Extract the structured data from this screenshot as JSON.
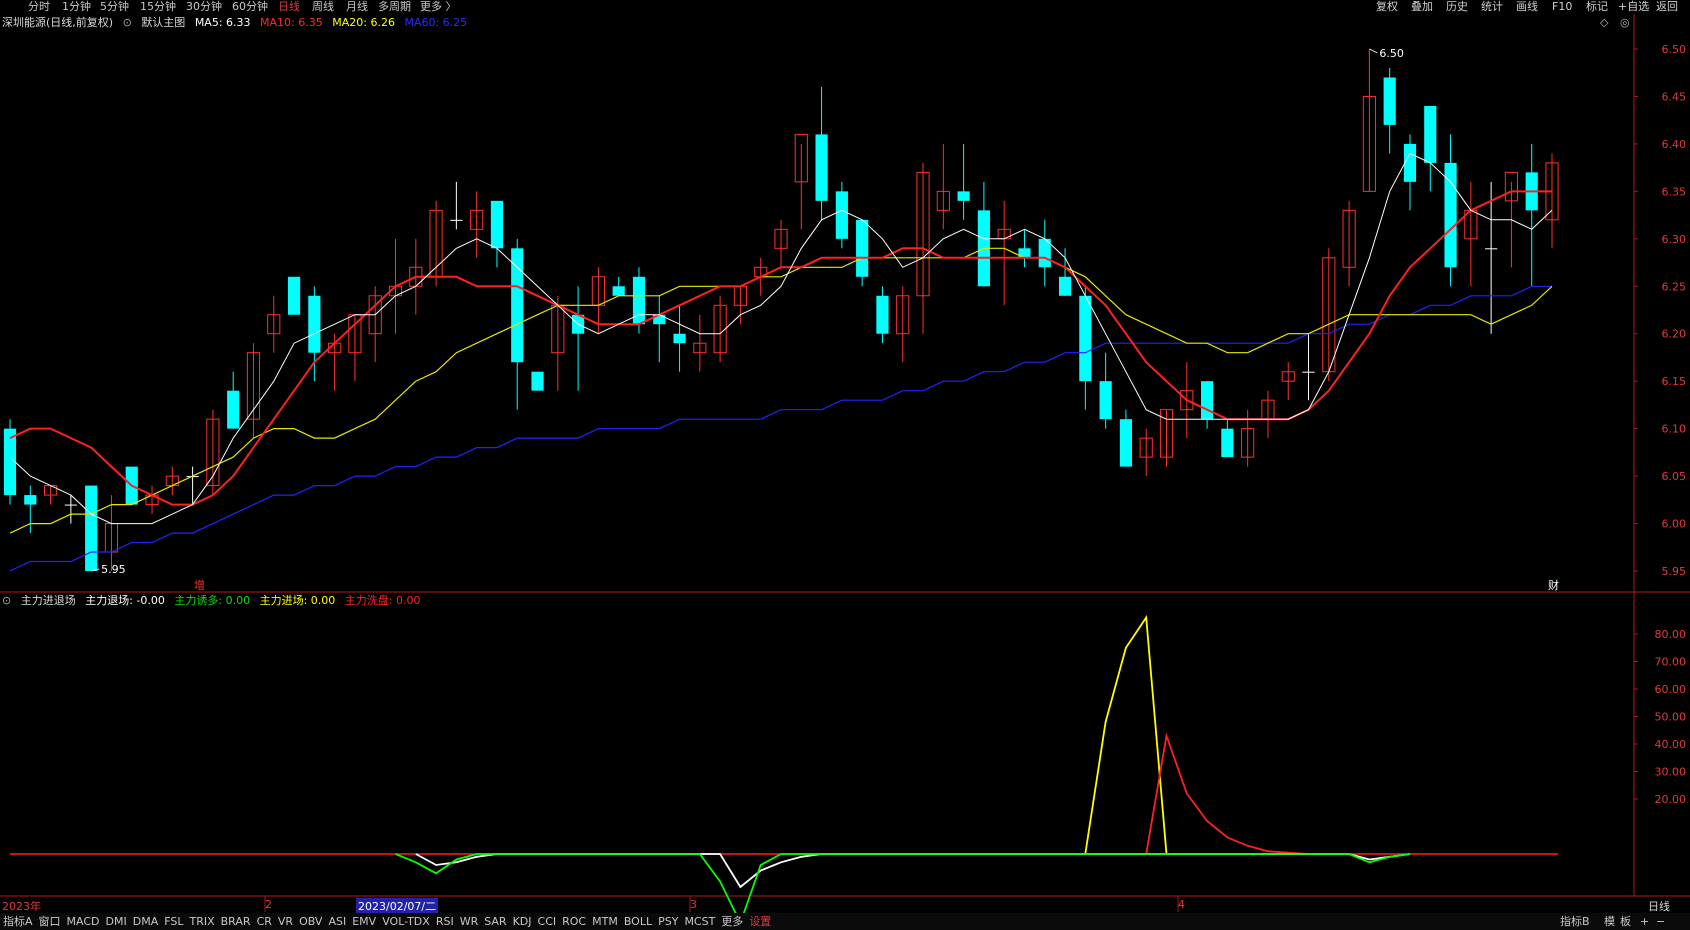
{
  "top_periods": [
    {
      "label": "分时",
      "active": false
    },
    {
      "label": "1分钟",
      "active": false
    },
    {
      "label": "5分钟",
      "active": false
    },
    {
      "label": "15分钟",
      "active": false
    },
    {
      "label": "30分钟",
      "active": false
    },
    {
      "label": "60分钟",
      "active": false
    },
    {
      "label": "日线",
      "active": true
    },
    {
      "label": "周线",
      "active": false
    },
    {
      "label": "月线",
      "active": false
    },
    {
      "label": "多周期",
      "active": false
    },
    {
      "label": "更多 〉",
      "active": false
    }
  ],
  "top_right": [
    "复权",
    "叠加",
    "历史",
    "统计",
    "画线",
    "F10",
    "标记",
    "+自选",
    "返回"
  ],
  "main_legend": {
    "stock": "深圳能源(日线,前复权)",
    "chart_name": "默认主图",
    "ma5": "MA5: 6.33",
    "ma10": "MA10: 6.35",
    "ma20": "MA20: 6.26",
    "ma60": "MA60: 6.25"
  },
  "sub_legend": {
    "name": "主力进退场",
    "exit": "主力退场: -0.00",
    "lure": "主力诱多: 0.00",
    "enter": "主力进场: 0.00",
    "wash": "主力洗盘: 0.00"
  },
  "main_axis": [
    "6.50",
    "6.45",
    "6.40",
    "6.35",
    "6.30",
    "6.25",
    "6.20",
    "6.15",
    "6.10",
    "6.05",
    "6.00",
    "5.95"
  ],
  "sub_axis": [
    "80.00",
    "70.00",
    "60.00",
    "50.00",
    "40.00",
    "30.00",
    "20.00"
  ],
  "annotations": {
    "high": "6.50",
    "low": "5.95",
    "zeng": "增",
    "cai": "财"
  },
  "time_axis": {
    "t1": "2023年",
    "t2": "2",
    "t3": "2023/02/07/二",
    "t4": "3",
    "t5": "4"
  },
  "period_label": "日线",
  "bottom_tabs": [
    {
      "label": "指标A",
      "red": false
    },
    {
      "label": "窗口",
      "red": false
    },
    {
      "label": "MACD",
      "red": false
    },
    {
      "label": "DMI",
      "red": false
    },
    {
      "label": "DMA",
      "red": false
    },
    {
      "label": "FSL",
      "red": false
    },
    {
      "label": "TRIX",
      "red": false
    },
    {
      "label": "BRAR",
      "red": false
    },
    {
      "label": "CR",
      "red": false
    },
    {
      "label": "VR",
      "red": false
    },
    {
      "label": "OBV",
      "red": false
    },
    {
      "label": "ASI",
      "red": false
    },
    {
      "label": "EMV",
      "red": false
    },
    {
      "label": "VOL-TDX",
      "red": false
    },
    {
      "label": "RSI",
      "red": false
    },
    {
      "label": "WR",
      "red": false
    },
    {
      "label": "SAR",
      "red": false
    },
    {
      "label": "KDJ",
      "red": false
    },
    {
      "label": "CCI",
      "red": false
    },
    {
      "label": "ROC",
      "red": false
    },
    {
      "label": "MTM",
      "red": false
    },
    {
      "label": "BOLL",
      "red": false
    },
    {
      "label": "PSY",
      "red": false
    },
    {
      "label": "MCST",
      "red": false
    },
    {
      "label": "更多",
      "red": false
    },
    {
      "label": "设置",
      "red": true
    }
  ],
  "bottom_right": [
    "指标B",
    "模",
    "板",
    "+",
    "−"
  ],
  "chart_data": [
    {
      "type": "candlestick",
      "title": "深圳能源(日线,前复权)",
      "ylim": [
        5.93,
        6.52
      ],
      "ohlc": [
        [
          6.1,
          6.11,
          6.02,
          6.03
        ],
        [
          6.03,
          6.04,
          5.99,
          6.02
        ],
        [
          6.03,
          6.04,
          6.02,
          6.04
        ],
        [
          6.02,
          6.03,
          6.0,
          6.02
        ],
        [
          6.04,
          6.04,
          5.95,
          5.95
        ],
        [
          5.97,
          6.03,
          5.95,
          6.0
        ],
        [
          6.06,
          6.06,
          6.02,
          6.02
        ],
        [
          6.02,
          6.04,
          6.01,
          6.03
        ],
        [
          6.04,
          6.06,
          6.03,
          6.05
        ],
        [
          6.05,
          6.06,
          6.02,
          6.05
        ],
        [
          6.04,
          6.12,
          6.03,
          6.11
        ],
        [
          6.14,
          6.16,
          6.1,
          6.1
        ],
        [
          6.11,
          6.19,
          6.09,
          6.18
        ],
        [
          6.2,
          6.24,
          6.18,
          6.22
        ],
        [
          6.26,
          6.26,
          6.22,
          6.22
        ],
        [
          6.24,
          6.25,
          6.15,
          6.18
        ],
        [
          6.18,
          6.2,
          6.14,
          6.19
        ],
        [
          6.18,
          6.22,
          6.15,
          6.22
        ],
        [
          6.2,
          6.25,
          6.17,
          6.24
        ],
        [
          6.24,
          6.3,
          6.2,
          6.25
        ],
        [
          6.25,
          6.3,
          6.22,
          6.27
        ],
        [
          6.26,
          6.34,
          6.25,
          6.33
        ],
        [
          6.32,
          6.36,
          6.31,
          6.32
        ],
        [
          6.31,
          6.35,
          6.28,
          6.33
        ],
        [
          6.34,
          6.34,
          6.27,
          6.29
        ],
        [
          6.29,
          6.3,
          6.12,
          6.17
        ],
        [
          6.16,
          6.16,
          6.14,
          6.14
        ],
        [
          6.18,
          6.24,
          6.14,
          6.23
        ],
        [
          6.22,
          6.25,
          6.14,
          6.2
        ],
        [
          6.23,
          6.27,
          6.2,
          6.26
        ],
        [
          6.25,
          6.26,
          6.24,
          6.24
        ],
        [
          6.26,
          6.27,
          6.2,
          6.21
        ],
        [
          6.22,
          6.24,
          6.17,
          6.21
        ],
        [
          6.2,
          6.23,
          6.16,
          6.19
        ],
        [
          6.18,
          6.22,
          6.16,
          6.19
        ],
        [
          6.18,
          6.24,
          6.17,
          6.23
        ],
        [
          6.23,
          6.25,
          6.21,
          6.25
        ],
        [
          6.26,
          6.28,
          6.24,
          6.27
        ],
        [
          6.29,
          6.32,
          6.27,
          6.31
        ],
        [
          6.36,
          6.4,
          6.31,
          6.41
        ],
        [
          6.41,
          6.46,
          6.32,
          6.34
        ],
        [
          6.35,
          6.36,
          6.29,
          6.3
        ],
        [
          6.32,
          6.32,
          6.25,
          6.26
        ],
        [
          6.24,
          6.25,
          6.19,
          6.2
        ],
        [
          6.2,
          6.25,
          6.17,
          6.24
        ],
        [
          6.24,
          6.38,
          6.2,
          6.37
        ],
        [
          6.33,
          6.4,
          6.31,
          6.35
        ],
        [
          6.35,
          6.4,
          6.32,
          6.34
        ],
        [
          6.33,
          6.36,
          6.25,
          6.25
        ],
        [
          6.3,
          6.34,
          6.23,
          6.31
        ],
        [
          6.29,
          6.31,
          6.27,
          6.28
        ],
        [
          6.3,
          6.32,
          6.25,
          6.27
        ],
        [
          6.26,
          6.29,
          6.24,
          6.24
        ],
        [
          6.24,
          6.25,
          6.12,
          6.15
        ],
        [
          6.15,
          6.18,
          6.1,
          6.11
        ],
        [
          6.11,
          6.12,
          6.06,
          6.06
        ],
        [
          6.07,
          6.1,
          6.05,
          6.09
        ],
        [
          6.07,
          6.12,
          6.06,
          6.12
        ],
        [
          6.12,
          6.17,
          6.09,
          6.14
        ],
        [
          6.15,
          6.15,
          6.1,
          6.11
        ],
        [
          6.1,
          6.11,
          6.07,
          6.07
        ],
        [
          6.07,
          6.12,
          6.06,
          6.1
        ],
        [
          6.11,
          6.14,
          6.09,
          6.13
        ],
        [
          6.15,
          6.17,
          6.13,
          6.16
        ],
        [
          6.16,
          6.2,
          6.13,
          6.16
        ],
        [
          6.16,
          6.29,
          6.15,
          6.28
        ],
        [
          6.27,
          6.34,
          6.25,
          6.33
        ],
        [
          6.35,
          6.5,
          6.35,
          6.45
        ],
        [
          6.47,
          6.48,
          6.39,
          6.42
        ],
        [
          6.4,
          6.41,
          6.33,
          6.36
        ],
        [
          6.44,
          6.44,
          6.35,
          6.38
        ],
        [
          6.38,
          6.41,
          6.25,
          6.27
        ],
        [
          6.3,
          6.36,
          6.25,
          6.33
        ],
        [
          6.29,
          6.36,
          6.2,
          6.29
        ],
        [
          6.34,
          6.36,
          6.27,
          6.37
        ],
        [
          6.37,
          6.4,
          6.25,
          6.33
        ],
        [
          6.32,
          6.39,
          6.29,
          6.38
        ]
      ],
      "ma5": [
        6.07,
        6.05,
        6.04,
        6.03,
        6.01,
        6.0,
        6.0,
        6.0,
        6.01,
        6.02,
        6.05,
        6.09,
        6.12,
        6.15,
        6.19,
        6.2,
        6.21,
        6.22,
        6.22,
        6.24,
        6.25,
        6.27,
        6.29,
        6.3,
        6.29,
        6.27,
        6.25,
        6.23,
        6.21,
        6.2,
        6.21,
        6.22,
        6.22,
        6.21,
        6.2,
        6.2,
        6.22,
        6.23,
        6.25,
        6.29,
        6.32,
        6.33,
        6.32,
        6.3,
        6.27,
        6.28,
        6.3,
        6.31,
        6.3,
        6.3,
        6.31,
        6.3,
        6.28,
        6.24,
        6.2,
        6.16,
        6.12,
        6.11,
        6.11,
        6.11,
        6.11,
        6.11,
        6.11,
        6.11,
        6.12,
        6.16,
        6.22,
        6.28,
        6.35,
        6.39,
        6.38,
        6.36,
        6.33,
        6.32,
        6.32,
        6.31,
        6.33
      ],
      "ma10": [
        6.09,
        6.1,
        6.1,
        6.09,
        6.08,
        6.06,
        6.04,
        6.03,
        6.02,
        6.02,
        6.03,
        6.05,
        6.08,
        6.11,
        6.14,
        6.17,
        6.19,
        6.21,
        6.23,
        6.25,
        6.26,
        6.26,
        6.26,
        6.25,
        6.25,
        6.25,
        6.24,
        6.23,
        6.22,
        6.21,
        6.21,
        6.21,
        6.22,
        6.23,
        6.24,
        6.25,
        6.25,
        6.26,
        6.27,
        6.27,
        6.28,
        6.28,
        6.28,
        6.28,
        6.29,
        6.29,
        6.28,
        6.28,
        6.28,
        6.28,
        6.28,
        6.28,
        6.27,
        6.25,
        6.23,
        6.2,
        6.17,
        6.15,
        6.13,
        6.12,
        6.11,
        6.11,
        6.11,
        6.11,
        6.12,
        6.14,
        6.17,
        6.2,
        6.24,
        6.27,
        6.29,
        6.31,
        6.33,
        6.34,
        6.35,
        6.35,
        6.35
      ],
      "ma20": [
        5.99,
        6.0,
        6.0,
        6.01,
        6.01,
        6.02,
        6.02,
        6.03,
        6.04,
        6.05,
        6.06,
        6.07,
        6.09,
        6.1,
        6.1,
        6.09,
        6.09,
        6.1,
        6.11,
        6.13,
        6.15,
        6.16,
        6.18,
        6.19,
        6.2,
        6.21,
        6.22,
        6.23,
        6.23,
        6.23,
        6.24,
        6.24,
        6.24,
        6.25,
        6.25,
        6.25,
        6.25,
        6.26,
        6.26,
        6.27,
        6.27,
        6.27,
        6.28,
        6.28,
        6.28,
        6.28,
        6.28,
        6.28,
        6.29,
        6.29,
        6.28,
        6.28,
        6.27,
        6.26,
        6.24,
        6.22,
        6.21,
        6.2,
        6.19,
        6.19,
        6.18,
        6.18,
        6.19,
        6.2,
        6.2,
        6.21,
        6.22,
        6.22,
        6.22,
        6.22,
        6.22,
        6.22,
        6.22,
        6.21,
        6.22,
        6.23,
        6.25
      ],
      "ma60": [
        5.95,
        5.96,
        5.96,
        5.96,
        5.97,
        5.97,
        5.98,
        5.98,
        5.99,
        5.99,
        6.0,
        6.01,
        6.02,
        6.03,
        6.03,
        6.04,
        6.04,
        6.05,
        6.05,
        6.06,
        6.06,
        6.07,
        6.07,
        6.08,
        6.08,
        6.09,
        6.09,
        6.09,
        6.09,
        6.1,
        6.1,
        6.1,
        6.1,
        6.11,
        6.11,
        6.11,
        6.11,
        6.11,
        6.12,
        6.12,
        6.12,
        6.13,
        6.13,
        6.13,
        6.14,
        6.14,
        6.15,
        6.15,
        6.16,
        6.16,
        6.17,
        6.17,
        6.18,
        6.18,
        6.19,
        6.19,
        6.19,
        6.19,
        6.19,
        6.19,
        6.19,
        6.19,
        6.19,
        6.19,
        6.2,
        6.2,
        6.21,
        6.21,
        6.22,
        6.22,
        6.23,
        6.23,
        6.24,
        6.24,
        6.24,
        6.25,
        6.25
      ]
    },
    {
      "type": "line",
      "title": "主力进退场",
      "ylim": [
        -15,
        90
      ],
      "series": [
        {
          "name": "主力进场",
          "color": "#ffff00",
          "values": [
            [
              53,
              0
            ],
            [
              54,
              48
            ],
            [
              55,
              75
            ],
            [
              56,
              86
            ],
            [
              57,
              0
            ]
          ]
        },
        {
          "name": "主力洗盘",
          "color": "#ff2020",
          "values": [
            [
              56,
              0
            ],
            [
              57,
              43
            ],
            [
              58,
              22
            ],
            [
              59,
              12
            ],
            [
              60,
              6
            ],
            [
              61,
              3
            ],
            [
              62,
              1
            ],
            [
              63,
              0.5
            ],
            [
              64,
              0
            ]
          ]
        },
        {
          "name": "主力退场",
          "color": "#ffffff",
          "values": [
            [
              20,
              0
            ],
            [
              21,
              -4
            ],
            [
              22,
              -3
            ],
            [
              23,
              -1
            ],
            [
              24,
              0
            ],
            [
              35,
              0
            ],
            [
              36,
              -12
            ],
            [
              37,
              -6
            ],
            [
              38,
              -3
            ],
            [
              39,
              -1
            ],
            [
              40,
              0
            ],
            [
              66,
              0
            ],
            [
              67,
              -2
            ],
            [
              68,
              -1
            ],
            [
              69,
              0
            ]
          ]
        },
        {
          "name": "主力诱多",
          "color": "#00ff00",
          "values": [
            [
              19,
              0
            ],
            [
              20,
              -3
            ],
            [
              21,
              -7
            ],
            [
              22,
              -2
            ],
            [
              23,
              0
            ],
            [
              34,
              0
            ],
            [
              35,
              -10
            ],
            [
              36,
              -25
            ],
            [
              37,
              -4
            ],
            [
              38,
              0
            ],
            [
              66,
              0
            ],
            [
              67,
              -3
            ],
            [
              68,
              -1
            ],
            [
              69,
              0
            ]
          ]
        }
      ]
    }
  ]
}
